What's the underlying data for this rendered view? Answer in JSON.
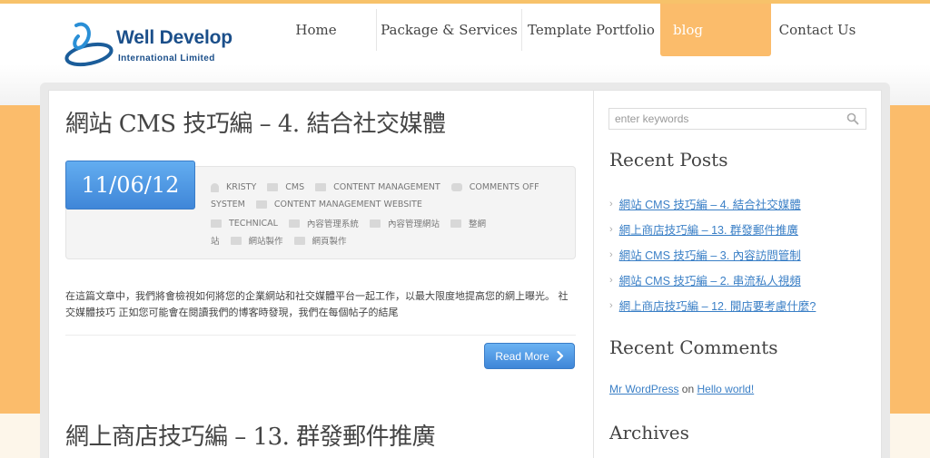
{
  "site": {
    "logo_name": "Well Develop",
    "logo_sub": "International Limited"
  },
  "nav": {
    "items": [
      {
        "label": "Home"
      },
      {
        "label": "Package & Services"
      },
      {
        "label": "Template Portfolio"
      },
      {
        "label": "blog"
      },
      {
        "label": "Contact Us"
      }
    ]
  },
  "posts": [
    {
      "title": "網站 CMS 技巧編 – 4. 結合社交媒體",
      "date": "11/06/12",
      "meta_row1": [
        {
          "icon": "user-icon",
          "text": "KRISTY"
        },
        {
          "icon": "folder-icon",
          "text": "CMS"
        },
        {
          "icon": "folder-icon",
          "text": "CONTENT MANAGEMENT"
        },
        {
          "icon": "comment-icon",
          "text": "COMMENTS OFF"
        }
      ],
      "meta_row2": [
        {
          "icon": "",
          "text": "SYSTEM"
        },
        {
          "icon": "folder-icon",
          "text": "CONTENT MANAGEMENT WEBSITE"
        }
      ],
      "meta_row3": [
        {
          "icon": "folder-icon",
          "text": "TECHNICAL"
        },
        {
          "icon": "folder-icon",
          "text": "內容管理系統"
        },
        {
          "icon": "folder-icon",
          "text": "內容管理網站"
        },
        {
          "icon": "folder-icon",
          "text": "整網"
        }
      ],
      "meta_row4": [
        {
          "icon": "",
          "text": "站"
        },
        {
          "icon": "folder-icon",
          "text": "網站製作"
        },
        {
          "icon": "folder-icon",
          "text": "網頁製作"
        }
      ],
      "excerpt": "在這篇文章中，我們將會檢視如何將您的企業網站和社交媒體平台一起工作，以最大限度地提高您的網上曝光。 社交媒體技巧 正如您可能會在閱讀我們的博客時發現，我們在每個帖子的結尾",
      "read_more": "Read More"
    },
    {
      "title": "網上商店技巧編 – 13. 群發郵件推廣"
    }
  ],
  "sidebar": {
    "search_placeholder": "enter keywords",
    "recent_posts_heading": "Recent Posts",
    "recent_posts": [
      "網站 CMS 技巧編 – 4. 結合社交媒體",
      "網上商店技巧編 – 13. 群發郵件推廣",
      "網站 CMS 技巧編 – 3. 內容訪問管制",
      "網站 CMS 技巧編 – 2. 串流私人視頻",
      "網上商店技巧編 – 12. 開店要考慮什麼?"
    ],
    "recent_comments_heading": "Recent Comments",
    "comment": {
      "author": "Mr WordPress",
      "on": "on",
      "post": "Hello world!"
    },
    "archives_heading": "Archives"
  },
  "colors": {
    "accent_orange": "#fbbc6b",
    "accent_blue": "#3f86d8",
    "link_blue": "#3a7fc6"
  }
}
